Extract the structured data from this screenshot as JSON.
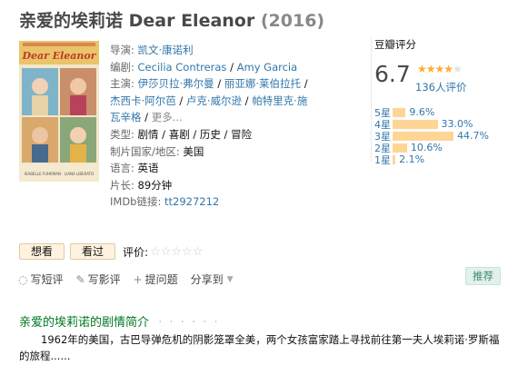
{
  "title": {
    "name": "亲爱的埃莉诺 Dear Eleanor",
    "year": "(2016)"
  },
  "poster": {
    "headline": "Dear Eleanor",
    "cast_line": "ISABELLE FUHRMAN · LIANA LIBERATO"
  },
  "info": {
    "director_label": "导演:",
    "director": "凯文·康诺利",
    "writer_label": "编剧:",
    "writers": [
      "Cecilia Contreras",
      "Amy Garcia"
    ],
    "cast_label": "主演:",
    "cast_line1": [
      "伊莎贝拉·弗尔曼",
      "丽亚娜·莱伯拉托"
    ],
    "cast_line2": [
      "杰西卡·阿尔芭",
      "卢克·威尔逊",
      "帕特里克·施"
    ],
    "cast_line3_name": "瓦辛格",
    "cast_more": "更多...",
    "genre_label": "类型:",
    "genres": [
      "剧情",
      "喜剧",
      "历史",
      "冒险"
    ],
    "country_label": "制片国家/地区:",
    "country": "美国",
    "language_label": "语言:",
    "language": "英语",
    "runtime_label": "片长:",
    "runtime": "89分钟",
    "imdb_label": "IMDb链接:",
    "imdb": "tt2927212"
  },
  "rating": {
    "label": "豆瓣评分",
    "score": "6.7",
    "star_fraction": 0.67,
    "votes": "136人评价",
    "distribution": [
      {
        "label": "5星",
        "pct": "9.6%",
        "value": 9.6
      },
      {
        "label": "4星",
        "pct": "33.0%",
        "value": 33.0
      },
      {
        "label": "3星",
        "pct": "44.7%",
        "value": 44.7
      },
      {
        "label": "2星",
        "pct": "10.6%",
        "value": 10.6
      },
      {
        "label": "1星",
        "pct": "2.1%",
        "value": 2.1
      }
    ]
  },
  "buttons": {
    "want": "想看",
    "seen": "看过",
    "rate_label": "评价:"
  },
  "actions": {
    "short_review": "写短评",
    "review": "写影评",
    "question": "提问题",
    "share": "分享到",
    "recommend": "推荐"
  },
  "summary": {
    "title": "亲爱的埃莉诺的剧情简介",
    "dots": "· · · · · ·",
    "text": "1962年的美国，古巴导弹危机的阴影笼罩全美，两个女孩富家踏上寻找前往第一夫人埃莉诺·罗斯福的旅程......"
  },
  "colors": {
    "link": "#3377aa",
    "star": "#ffac2d",
    "bar": "#ffd596",
    "summary_title": "#007722"
  }
}
